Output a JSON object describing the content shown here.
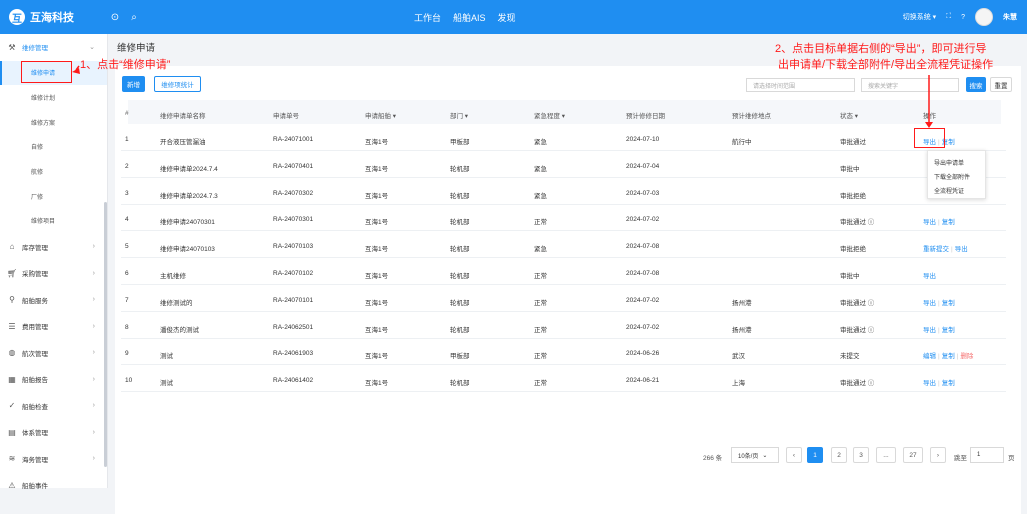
{
  "app": {
    "name": "互海科技",
    "icons": [
      "expand-icon",
      "search-icon"
    ]
  },
  "topnav": [
    "工作台",
    "船舶AIS",
    "发现"
  ],
  "topright": {
    "switch_system": "切换系统 ▾",
    "user": "朱慧"
  },
  "sidebar": {
    "items": [
      {
        "label": "维修管理",
        "icon": "wrench-icon",
        "expanded": true,
        "children": [
          "维修申请",
          "维修计划",
          "维修方案",
          "自修",
          "航修",
          "厂修",
          "维修项目"
        ]
      },
      {
        "label": "库存管理",
        "icon": "home-icon"
      },
      {
        "label": "采购管理",
        "icon": "cart-icon"
      },
      {
        "label": "船舶服务",
        "icon": "service-icon"
      },
      {
        "label": "费用管理",
        "icon": "database-icon"
      },
      {
        "label": "航次管理",
        "icon": "globe-icon"
      },
      {
        "label": "船舶报告",
        "icon": "report-icon"
      },
      {
        "label": "船舶检查",
        "icon": "check-icon"
      },
      {
        "label": "体系管理",
        "icon": "book-icon"
      },
      {
        "label": "海务管理",
        "icon": "sea-icon"
      },
      {
        "label": "船舶事件",
        "icon": "warning-icon"
      }
    ]
  },
  "page": {
    "title": "维修申请"
  },
  "toolbar": {
    "new_label": "新增",
    "stats_label": "维修项统计",
    "date_placeholder": "请选择时间范围",
    "keyword_placeholder": "搜索关键字",
    "search_label": "搜索",
    "reset_label": "重置"
  },
  "table": {
    "headers": [
      "#",
      "维修申请单名称",
      "申请单号",
      "申请船舶 ▾",
      "部门 ▾",
      "紧急程度 ▾",
      "预计修修日期",
      "预计维修地点",
      "状态 ▾",
      "操作"
    ],
    "rows": [
      {
        "no": "1",
        "name": "开合液压管漏油",
        "code": "RA-24071001",
        "ship": "互海1号",
        "dept": "甲板部",
        "urgency": "紧急",
        "date": "2024-07-10",
        "place": "航行中",
        "status": "审批通过",
        "ops": [
          "导出",
          "复制"
        ]
      },
      {
        "no": "2",
        "name": "维修申请单2024.7.4",
        "code": "RA-24070401",
        "ship": "互海1号",
        "dept": "轮机部",
        "urgency": "紧急",
        "date": "2024-07-04",
        "place": "",
        "status": "审批中",
        "ops": []
      },
      {
        "no": "3",
        "name": "维修申请单2024.7.3",
        "code": "RA-24070302",
        "ship": "互海1号",
        "dept": "轮机部",
        "urgency": "紧急",
        "date": "2024-07-03",
        "place": "",
        "status": "审批拒绝",
        "ops": []
      },
      {
        "no": "4",
        "name": "维修申请24070301",
        "code": "RA-24070301",
        "ship": "互海1号",
        "dept": "轮机部",
        "urgency": "正常",
        "date": "2024-07-02",
        "place": "",
        "status": "审批通过",
        "ops": [
          "导出",
          "复制"
        ]
      },
      {
        "no": "5",
        "name": "维修申请24070103",
        "code": "RA-24070103",
        "ship": "互海1号",
        "dept": "轮机部",
        "urgency": "紧急",
        "date": "2024-07-08",
        "place": "",
        "status": "审批拒绝",
        "ops": [
          "重新提交",
          "导出"
        ]
      },
      {
        "no": "6",
        "name": "主机维修",
        "code": "RA-24070102",
        "ship": "互海1号",
        "dept": "轮机部",
        "urgency": "正常",
        "date": "2024-07-08",
        "place": "",
        "status": "审批中",
        "ops": [
          "导出"
        ]
      },
      {
        "no": "7",
        "name": "维修测试的",
        "code": "RA-24070101",
        "ship": "互海1号",
        "dept": "轮机部",
        "urgency": "正常",
        "date": "2024-07-02",
        "place": "扬州港",
        "status": "审批通过",
        "ops": [
          "导出",
          "复制"
        ]
      },
      {
        "no": "8",
        "name": "潘俊杰的测试",
        "code": "RA-24062501",
        "ship": "互海1号",
        "dept": "轮机部",
        "urgency": "正常",
        "date": "2024-07-02",
        "place": "扬州港",
        "status": "审批通过",
        "ops": [
          "导出",
          "复制"
        ]
      },
      {
        "no": "9",
        "name": "测试",
        "code": "RA-24061903",
        "ship": "互海1号",
        "dept": "甲板部",
        "urgency": "正常",
        "date": "2024-06-26",
        "place": "武汉",
        "status": "未提交",
        "ops": [
          "编辑",
          "复制",
          "删除"
        ]
      },
      {
        "no": "10",
        "name": "测试",
        "code": "RA-24061402",
        "ship": "互海1号",
        "dept": "轮机部",
        "urgency": "正常",
        "date": "2024-06-21",
        "place": "上海",
        "status": "审批通过",
        "ops": [
          "导出",
          "复制"
        ]
      }
    ]
  },
  "dropdown": [
    "导出申请单",
    "下载全部附件",
    "全流程凭证"
  ],
  "annotations": {
    "a1": "1、点击“维修申请”",
    "a2_line1": "2、点击目标单据右侧的“导出”，即可进行导",
    "a2_line2": "出申请单/下载全部附件/导出全流程凭证操作"
  },
  "pagination": {
    "total": "266 条",
    "page_size": "10条/页",
    "pages": [
      "1",
      "2",
      "3",
      "...",
      "27"
    ],
    "goto_label": "跳至",
    "goto_value": "1",
    "page_suffix": "页"
  },
  "colors": {
    "primary": "#1f8ef1",
    "annotation": "#ff1a1a"
  }
}
